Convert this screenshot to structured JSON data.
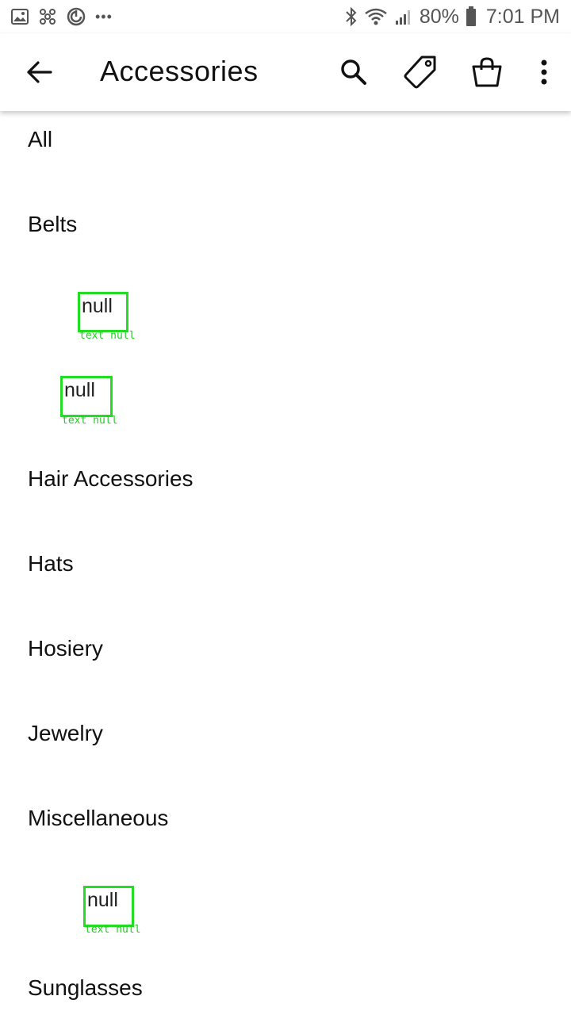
{
  "status_bar": {
    "left_icons": [
      "gallery-icon",
      "pinwheel-icon",
      "sync-icon",
      "more-dots"
    ],
    "more_dots": "•••",
    "right_icons": [
      "bluetooth-icon",
      "wifi-icon",
      "signal-icon",
      "battery-icon"
    ],
    "battery": "80%",
    "time": "7:01 PM"
  },
  "app_bar": {
    "title": "Accessories",
    "actions": [
      "search-icon",
      "tag-icon",
      "shopping-bag-icon",
      "more-vert-icon"
    ]
  },
  "categories": {
    "all": "All",
    "belts": "Belts",
    "hair": "Hair Accessories",
    "hats": "Hats",
    "hosiery": "Hosiery",
    "jewelry": "Jewelry",
    "misc": "Miscellaneous",
    "sunglasses": "Sunglasses"
  },
  "placeholders": [
    {
      "text": "null",
      "caption": "text null"
    },
    {
      "text": "null",
      "caption": "text null"
    },
    {
      "text": "null",
      "caption": "text null"
    }
  ],
  "colors": {
    "debug_box": "#22dd22",
    "text": "#111111",
    "background": "#ffffff"
  }
}
